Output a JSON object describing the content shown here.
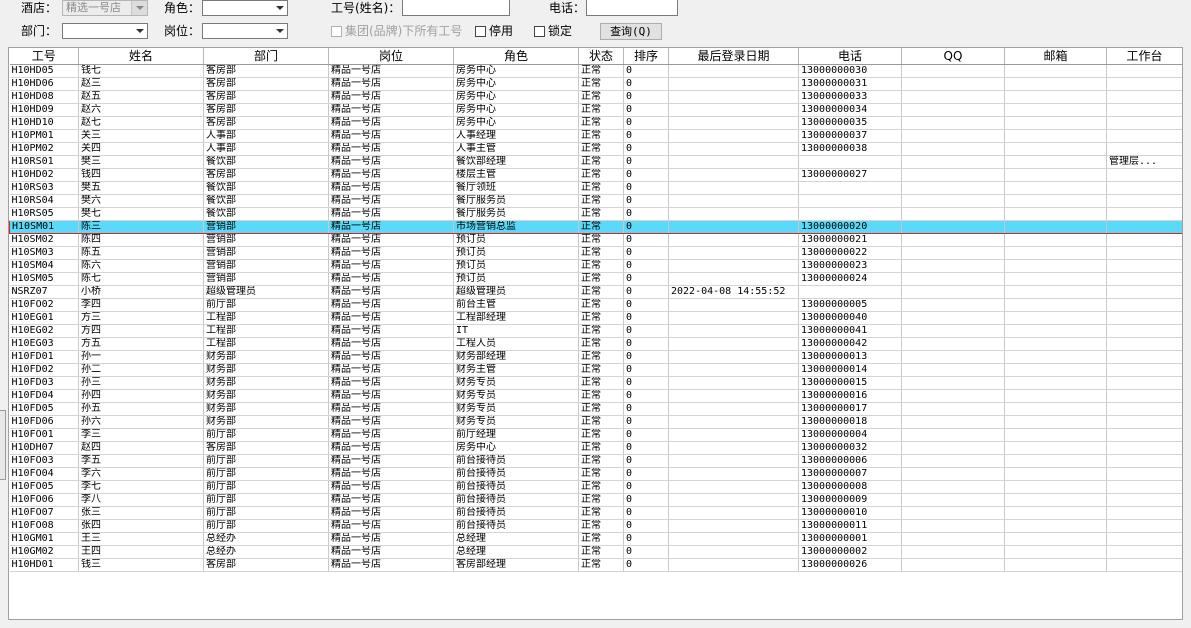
{
  "filters": {
    "hotel_label": "酒店：",
    "hotel_value": "精选一号店",
    "role_label": "角色：",
    "role_value": "",
    "empno_label": "工号(姓名)：",
    "empno_value": "",
    "phone_label": "电话：",
    "phone_value": "",
    "dept_label": "部门：",
    "dept_value": "",
    "position_label": "岗位：",
    "position_value": "",
    "group_all_label": "集团(品牌)下所有工号",
    "disabled_label": "停用",
    "locked_label": "锁定",
    "query_button": "查询(Q)"
  },
  "table": {
    "columns": [
      "工号",
      "姓名",
      "部门",
      "岗位",
      "角色",
      "状态",
      "排序",
      "最后登录日期",
      "电话",
      "QQ",
      "邮箱",
      "工作台"
    ],
    "selected_row_index": 13,
    "rows": [
      [
        "H10HD05",
        "钱七",
        "客房部",
        "精品一号店",
        "房务中心",
        "正常",
        "0",
        "",
        "13000000030",
        "",
        "",
        ""
      ],
      [
        "H10HD06",
        "赵三",
        "客房部",
        "精品一号店",
        "房务中心",
        "正常",
        "0",
        "",
        "13000000031",
        "",
        "",
        ""
      ],
      [
        "H10HD08",
        "赵五",
        "客房部",
        "精品一号店",
        "房务中心",
        "正常",
        "0",
        "",
        "13000000033",
        "",
        "",
        ""
      ],
      [
        "H10HD09",
        "赵六",
        "客房部",
        "精品一号店",
        "房务中心",
        "正常",
        "0",
        "",
        "13000000034",
        "",
        "",
        ""
      ],
      [
        "H10HD10",
        "赵七",
        "客房部",
        "精品一号店",
        "房务中心",
        "正常",
        "0",
        "",
        "13000000035",
        "",
        "",
        ""
      ],
      [
        "H10PM01",
        "关三",
        "人事部",
        "精品一号店",
        "人事经理",
        "正常",
        "0",
        "",
        "13000000037",
        "",
        "",
        ""
      ],
      [
        "H10PM02",
        "关四",
        "人事部",
        "精品一号店",
        "人事主管",
        "正常",
        "0",
        "",
        "13000000038",
        "",
        "",
        ""
      ],
      [
        "H10RS01",
        "樊三",
        "餐饮部",
        "精品一号店",
        "餐饮部经理",
        "正常",
        "0",
        "",
        "",
        "",
        "",
        "管理层..."
      ],
      [
        "H10HD02",
        "钱四",
        "客房部",
        "精品一号店",
        "楼层主管",
        "正常",
        "0",
        "",
        "13000000027",
        "",
        "",
        ""
      ],
      [
        "H10RS03",
        "樊五",
        "餐饮部",
        "精品一号店",
        "餐厅领班",
        "正常",
        "0",
        "",
        "",
        "",
        "",
        ""
      ],
      [
        "H10RS04",
        "樊六",
        "餐饮部",
        "精品一号店",
        "餐厅服务员",
        "正常",
        "0",
        "",
        "",
        "",
        "",
        ""
      ],
      [
        "H10RS05",
        "樊七",
        "餐饮部",
        "精品一号店",
        "餐厅服务员",
        "正常",
        "0",
        "",
        "",
        "",
        "",
        ""
      ],
      [
        "H10SM01",
        "陈三",
        "营销部",
        "精品一号店",
        "市场营销总监",
        "正常",
        "0",
        "",
        "13000000020",
        "",
        "",
        ""
      ],
      [
        "H10SM02",
        "陈四",
        "营销部",
        "精品一号店",
        "预订员",
        "正常",
        "0",
        "",
        "13000000021",
        "",
        "",
        ""
      ],
      [
        "H10SM03",
        "陈五",
        "营销部",
        "精品一号店",
        "预订员",
        "正常",
        "0",
        "",
        "13000000022",
        "",
        "",
        ""
      ],
      [
        "H10SM04",
        "陈六",
        "营销部",
        "精品一号店",
        "预订员",
        "正常",
        "0",
        "",
        "13000000023",
        "",
        "",
        ""
      ],
      [
        "H10SM05",
        "陈七",
        "营销部",
        "精品一号店",
        "预订员",
        "正常",
        "0",
        "",
        "13000000024",
        "",
        "",
        ""
      ],
      [
        "NSRZ07",
        "小桥",
        "超级管理员",
        "精品一号店",
        "超级管理员",
        "正常",
        "0",
        "2022-04-08 14:55:52",
        "",
        "",
        "",
        ""
      ],
      [
        "H10FO02",
        "李四",
        "前厅部",
        "精品一号店",
        "前台主管",
        "正常",
        "0",
        "",
        "13000000005",
        "",
        "",
        ""
      ],
      [
        "H10EG01",
        "方三",
        "工程部",
        "精品一号店",
        "工程部经理",
        "正常",
        "0",
        "",
        "13000000040",
        "",
        "",
        ""
      ],
      [
        "H10EG02",
        "方四",
        "工程部",
        "精品一号店",
        "IT",
        "正常",
        "0",
        "",
        "13000000041",
        "",
        "",
        ""
      ],
      [
        "H10EG03",
        "方五",
        "工程部",
        "精品一号店",
        "工程人员",
        "正常",
        "0",
        "",
        "13000000042",
        "",
        "",
        ""
      ],
      [
        "H10FD01",
        "孙一",
        "财务部",
        "精品一号店",
        "财务部经理",
        "正常",
        "0",
        "",
        "13000000013",
        "",
        "",
        ""
      ],
      [
        "H10FD02",
        "孙二",
        "财务部",
        "精品一号店",
        "财务主管",
        "正常",
        "0",
        "",
        "13000000014",
        "",
        "",
        ""
      ],
      [
        "H10FD03",
        "孙三",
        "财务部",
        "精品一号店",
        "财务专员",
        "正常",
        "0",
        "",
        "13000000015",
        "",
        "",
        ""
      ],
      [
        "H10FD04",
        "孙四",
        "财务部",
        "精品一号店",
        "财务专员",
        "正常",
        "0",
        "",
        "13000000016",
        "",
        "",
        ""
      ],
      [
        "H10FD05",
        "孙五",
        "财务部",
        "精品一号店",
        "财务专员",
        "正常",
        "0",
        "",
        "13000000017",
        "",
        "",
        ""
      ],
      [
        "H10FD06",
        "孙六",
        "财务部",
        "精品一号店",
        "财务专员",
        "正常",
        "0",
        "",
        "13000000018",
        "",
        "",
        ""
      ],
      [
        "H10FO01",
        "李三",
        "前厅部",
        "精品一号店",
        "前厅经理",
        "正常",
        "0",
        "",
        "13000000004",
        "",
        "",
        ""
      ],
      [
        "H10DH07",
        "赵四",
        "客房部",
        "精品一号店",
        "房务中心",
        "正常",
        "0",
        "",
        "13000000032",
        "",
        "",
        ""
      ],
      [
        "H10FO03",
        "李五",
        "前厅部",
        "精品一号店",
        "前台接待员",
        "正常",
        "0",
        "",
        "13000000006",
        "",
        "",
        ""
      ],
      [
        "H10FO04",
        "李六",
        "前厅部",
        "精品一号店",
        "前台接待员",
        "正常",
        "0",
        "",
        "13000000007",
        "",
        "",
        ""
      ],
      [
        "H10FO05",
        "李七",
        "前厅部",
        "精品一号店",
        "前台接待员",
        "正常",
        "0",
        "",
        "13000000008",
        "",
        "",
        ""
      ],
      [
        "H10FO06",
        "李八",
        "前厅部",
        "精品一号店",
        "前台接待员",
        "正常",
        "0",
        "",
        "13000000009",
        "",
        "",
        ""
      ],
      [
        "H10FO07",
        "张三",
        "前厅部",
        "精品一号店",
        "前台接待员",
        "正常",
        "0",
        "",
        "13000000010",
        "",
        "",
        ""
      ],
      [
        "H10FO08",
        "张四",
        "前厅部",
        "精品一号店",
        "前台接待员",
        "正常",
        "0",
        "",
        "13000000011",
        "",
        "",
        ""
      ],
      [
        "H10GM01",
        "王三",
        "总经办",
        "精品一号店",
        "总经理",
        "正常",
        "0",
        "",
        "13000000001",
        "",
        "",
        ""
      ],
      [
        "H10GM02",
        "王四",
        "总经办",
        "精品一号店",
        "总经理",
        "正常",
        "0",
        "",
        "13000000002",
        "",
        "",
        ""
      ],
      [
        "H10HD01",
        "钱三",
        "客房部",
        "精品一号店",
        "客房部经理",
        "正常",
        "0",
        "",
        "13000000026",
        "",
        "",
        ""
      ]
    ]
  },
  "colors": {
    "selected_row_bg": "#5ad9f8",
    "selected_row_border": "#e02020"
  }
}
